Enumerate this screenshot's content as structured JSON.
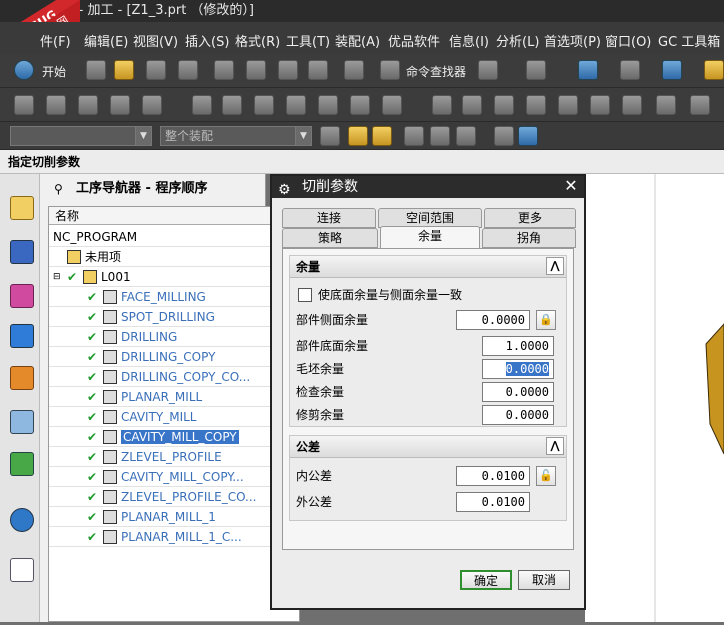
{
  "window": {
    "title": "23 - 加工 - [Z1_3.prt （修改的）]"
  },
  "watermark": {
    "line1": "9SUG",
    "line2": "学UG就上UG网"
  },
  "menu": [
    "件(F)",
    "编辑(E)",
    "视图(V)",
    "插入(S)",
    "格式(R)",
    "工具(T)",
    "装配(A)",
    "优品软件",
    "信息(I)",
    "分析(L)",
    "首选项(P)",
    "窗口(O)",
    "GC 工具箱"
  ],
  "toolbar": {
    "start_label": "开始",
    "cmd_finder_label": "命令查找器",
    "filter_placeholder": "",
    "assembly_combo": "整个装配"
  },
  "prompt": {
    "text": "指定切削参数"
  },
  "navigator": {
    "title": "工序导航器 - 程序顺序",
    "column_header": "名称",
    "root": "NC_PROGRAM",
    "unused": "未用项",
    "group": "L001",
    "operations": [
      {
        "name": "FACE_MILLING",
        "selected": false
      },
      {
        "name": "SPOT_DRILLING",
        "selected": false
      },
      {
        "name": "DRILLING",
        "selected": false
      },
      {
        "name": "DRILLING_COPY",
        "selected": false
      },
      {
        "name": "DRILLING_COPY_CO...",
        "selected": false
      },
      {
        "name": "PLANAR_MILL",
        "selected": false
      },
      {
        "name": "CAVITY_MILL",
        "selected": false
      },
      {
        "name": "CAVITY_MILL_COPY",
        "selected": true
      },
      {
        "name": "ZLEVEL_PROFILE",
        "selected": false
      },
      {
        "name": "CAVITY_MILL_COPY...",
        "selected": false
      },
      {
        "name": "ZLEVEL_PROFILE_CO...",
        "selected": false
      },
      {
        "name": "PLANAR_MILL_1",
        "selected": false
      },
      {
        "name": "PLANAR_MILL_1_C...",
        "selected": false
      }
    ]
  },
  "dialog": {
    "title": "切削参数",
    "tabs_top": [
      "连接",
      "空间范围",
      "更多"
    ],
    "tabs_bottom": [
      "策略",
      "余量",
      "拐角"
    ],
    "active_tab": "余量",
    "stock_group": {
      "title": "余量",
      "checkbox_label": "使底面余量与侧面余量一致",
      "part_side_stock_label": "部件侧面余量",
      "part_side_stock": "0.0000",
      "part_floor_stock_label": "部件底面余量",
      "part_floor_stock": "1.0000",
      "blank_stock_label": "毛坯余量",
      "blank_stock": "0.0000",
      "check_stock_label": "检查余量",
      "check_stock": "0.0000",
      "trim_stock_label": "修剪余量",
      "trim_stock": "0.0000"
    },
    "tolerance_group": {
      "title": "公差",
      "intol_label": "内公差",
      "intol": "0.0100",
      "outtol_label": "外公差",
      "outtol": "0.0100"
    },
    "ok_label": "确定",
    "cancel_label": "取消"
  }
}
